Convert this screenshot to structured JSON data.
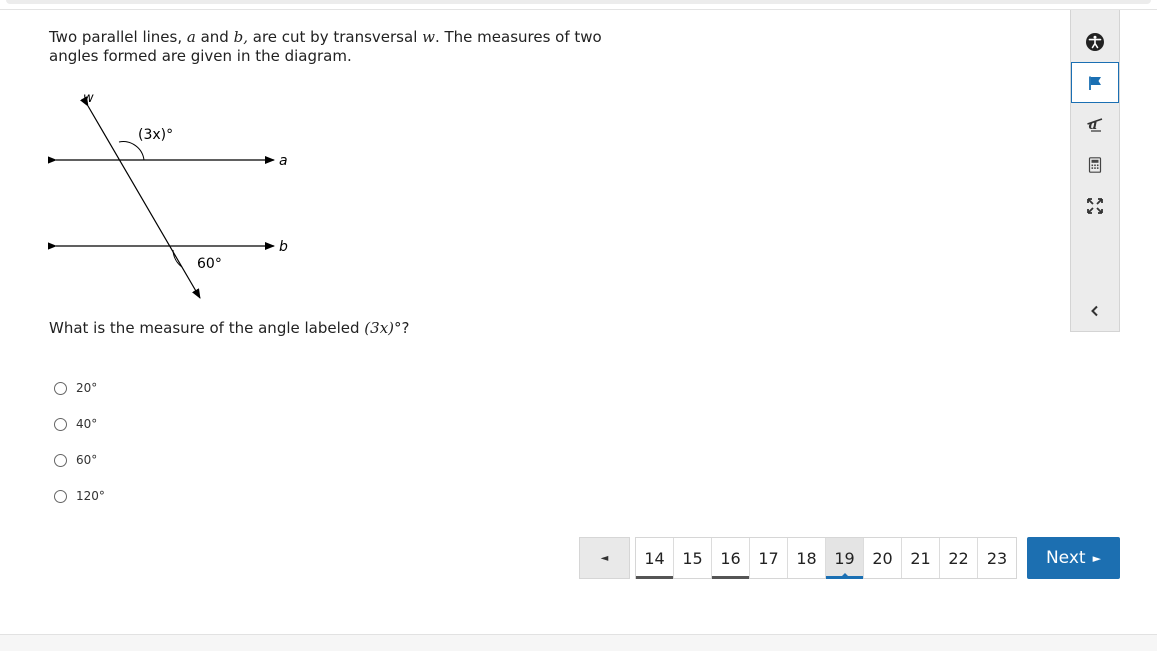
{
  "question": {
    "intro_1": "Two parallel lines, ",
    "line_a": "a",
    "and": " and ",
    "line_b": "b,",
    "intro_2": " are cut by transversal ",
    "transversal": "w",
    "intro_3": ". The measures of two angles formed are given in the diagram."
  },
  "diagram": {
    "label_w": "w",
    "label_a": "a",
    "label_b": "b",
    "angle_top": "(3x)°",
    "angle_bottom": "60°"
  },
  "prompt": {
    "text": "What is the measure of the angle labeled ",
    "expr": "(3x)",
    "degree": "°",
    "qmark": "?"
  },
  "choices": [
    "20°",
    "40°",
    "60°",
    "120°"
  ],
  "toolbar": {
    "icons": [
      "accessibility-icon",
      "flag-icon",
      "strikethrough-icon",
      "calculator-icon",
      "expand-icon",
      "collapse-icon"
    ],
    "accent": "#1a6fb3"
  },
  "pager": {
    "prev_symbol": "◄",
    "pages": [
      "14",
      "15",
      "16",
      "17",
      "18",
      "19",
      "20",
      "21",
      "22",
      "23"
    ],
    "current": "19",
    "answered": [
      "14",
      "16"
    ]
  },
  "next": {
    "label": "Next",
    "arrow": "►",
    "color": "#1c6fb1"
  }
}
